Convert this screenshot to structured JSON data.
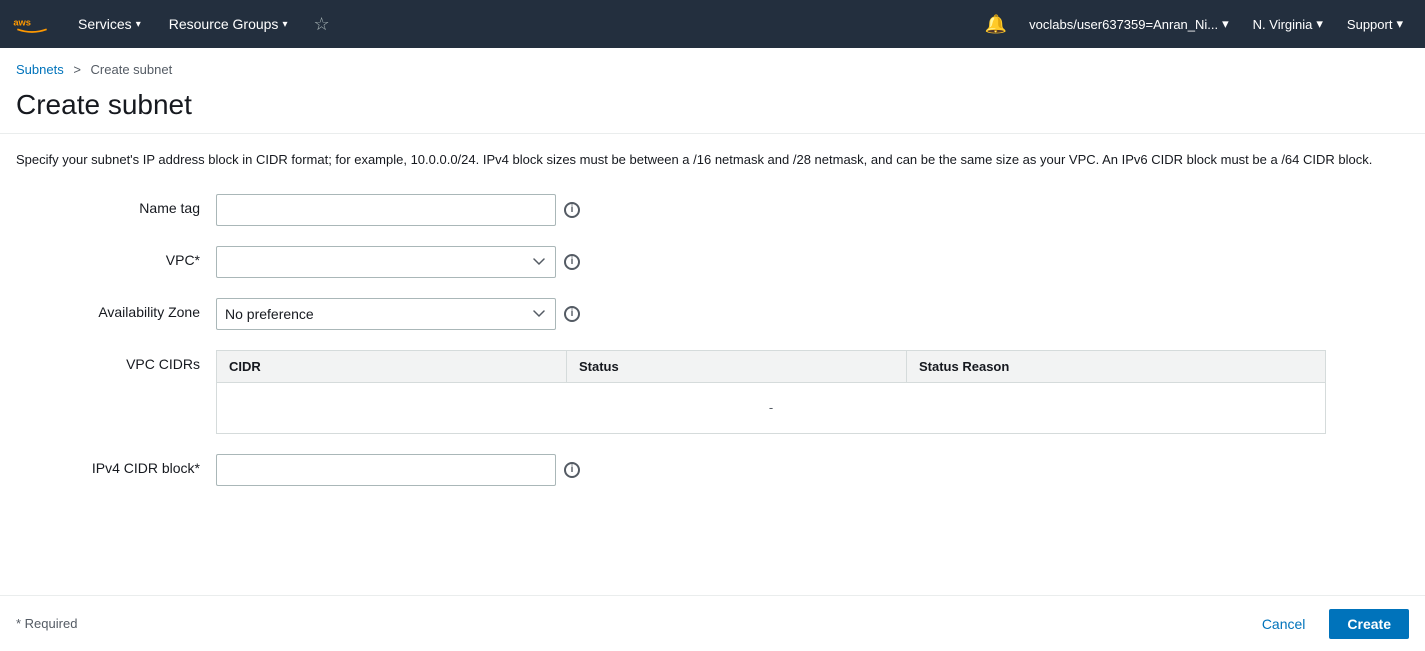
{
  "topnav": {
    "services_label": "Services",
    "resource_groups_label": "Resource Groups",
    "account_label": "voclabs/user637359=Anran_Ni...",
    "region_label": "N. Virginia",
    "support_label": "Support"
  },
  "breadcrumb": {
    "subnets_link": "Subnets",
    "separator": ">",
    "current": "Create subnet"
  },
  "page": {
    "title": "Create subnet",
    "description": "Specify your subnet's IP address block in CIDR format; for example, 10.0.0.0/24. IPv4 block sizes must be between a /16 netmask and /28 netmask, and can be the same size as your VPC. An IPv6 CIDR block must be a /64 CIDR block."
  },
  "form": {
    "name_tag_label": "Name tag",
    "name_tag_value": "",
    "vpc_label": "VPC*",
    "vpc_value": "",
    "availability_zone_label": "Availability Zone",
    "availability_zone_value": "No preference",
    "vpc_cidrs_label": "VPC CIDRs",
    "ipv4_cidr_label": "IPv4 CIDR block*",
    "ipv4_cidr_value": ""
  },
  "table": {
    "columns": [
      "CIDR",
      "Status",
      "Status Reason"
    ],
    "empty_value": "-"
  },
  "footer": {
    "required_label": "* Required",
    "cancel_label": "Cancel",
    "create_label": "Create"
  },
  "icons": {
    "info": "i",
    "bell": "🔔",
    "caret": "▾",
    "star": "☆"
  }
}
